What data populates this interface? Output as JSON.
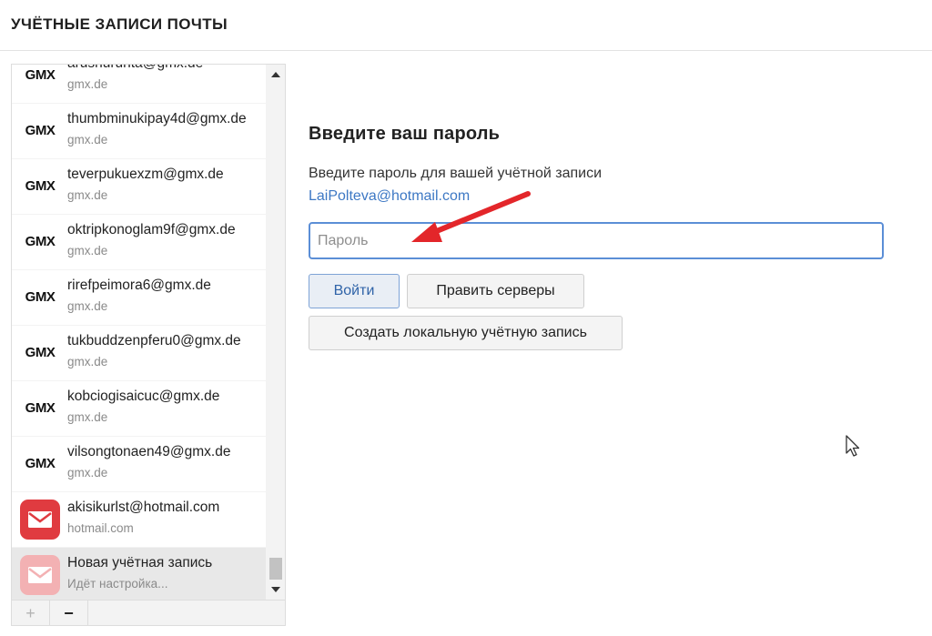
{
  "header": {
    "title": "УЧЁТНЫЕ ЗАПИСИ ПОЧТЫ"
  },
  "accounts": [
    {
      "email": "arushurunta@gmx.de",
      "domain": "gmx.de",
      "icon": "gmx-logo"
    },
    {
      "email": "thumbminukipay4d@gmx.de",
      "domain": "gmx.de",
      "icon": "gmx-logo"
    },
    {
      "email": "teverpukuexzm@gmx.de",
      "domain": "gmx.de",
      "icon": "gmx-logo"
    },
    {
      "email": "oktripkonoglam9f@gmx.de",
      "domain": "gmx.de",
      "icon": "gmx-logo"
    },
    {
      "email": "rirefpeimora6@gmx.de",
      "domain": "gmx.de",
      "icon": "gmx-logo"
    },
    {
      "email": "tukbuddzenpferu0@gmx.de",
      "domain": "gmx.de",
      "icon": "gmx-logo"
    },
    {
      "email": "kobciogisaicuc@gmx.de",
      "domain": "gmx.de",
      "icon": "gmx-logo"
    },
    {
      "email": "vilsongtonaen49@gmx.de",
      "domain": "gmx.de",
      "icon": "gmx-logo"
    },
    {
      "email": "akisikurlst@hotmail.com",
      "domain": "hotmail.com",
      "icon": "mail-envelope-icon"
    },
    {
      "email": "Новая учётная запись",
      "domain": "Идёт настройка...",
      "icon": "mail-envelope-icon",
      "selected": true
    }
  ],
  "gmx_label": "GMX",
  "sidebar_footer": {
    "add": "+",
    "remove": "−"
  },
  "login": {
    "title": "Введите ваш пароль",
    "description": "Введите пароль для вашей учётной записи",
    "email": "LaiPolteva@hotmail.com",
    "password_placeholder": "Пароль",
    "login_button": "Войти",
    "servers_button": "Править серверы",
    "local_button": "Создать локальную учётную запись"
  },
  "colors": {
    "accent": "#5b8ed6",
    "link": "#3d78c4",
    "mail_red": "#e03b40",
    "arrow_red": "#e3262a"
  }
}
